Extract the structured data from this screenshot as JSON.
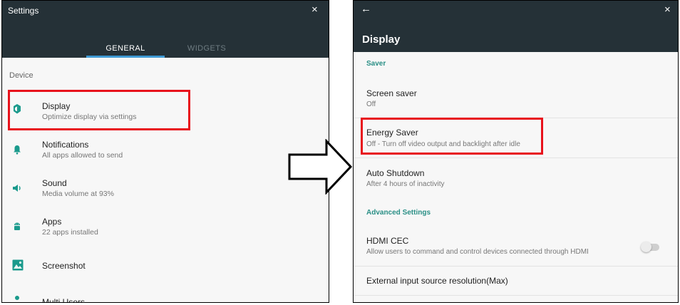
{
  "left_panel": {
    "window_title": "Settings",
    "close_label": "×",
    "tabs": [
      {
        "label": "GENERAL",
        "active": true
      },
      {
        "label": "WIDGETS",
        "active": false
      }
    ],
    "section_label": "Device",
    "items": [
      {
        "title": "Display",
        "subtitle": "Optimize display via settings",
        "icon": "brightness-icon"
      },
      {
        "title": "Notifications",
        "subtitle": "All apps allowed to send",
        "icon": "bell-icon"
      },
      {
        "title": "Sound",
        "subtitle": "Media volume at 93%",
        "icon": "volume-icon"
      },
      {
        "title": "Apps",
        "subtitle": "22 apps installed",
        "icon": "android-icon"
      },
      {
        "title": "Screenshot",
        "subtitle": "",
        "icon": "image-icon"
      },
      {
        "title": "Multi Users",
        "subtitle": "",
        "icon": "user-icon"
      }
    ]
  },
  "right_panel": {
    "back_label": "←",
    "close_label": "×",
    "title": "Display",
    "section_saver": "Saver",
    "items": [
      {
        "title": "Screen saver",
        "subtitle": "Off"
      },
      {
        "title": "Energy Saver",
        "subtitle": "Off - Turn off video output and backlight after idle"
      },
      {
        "title": "Auto Shutdown",
        "subtitle": "After 4 hours of inactivity"
      }
    ],
    "section_advanced": "Advanced Settings",
    "hdmi": {
      "title": "HDMI CEC",
      "subtitle": "Allow users to command and control devices connected through HDMI",
      "toggle_on": false
    },
    "external": {
      "title": "External input source resolution(Max)"
    }
  },
  "colors": {
    "header_bg": "#253137",
    "accent_blue": "#3f9ad4",
    "accent_teal": "#2a8f86",
    "highlight_red": "#e8121c"
  }
}
